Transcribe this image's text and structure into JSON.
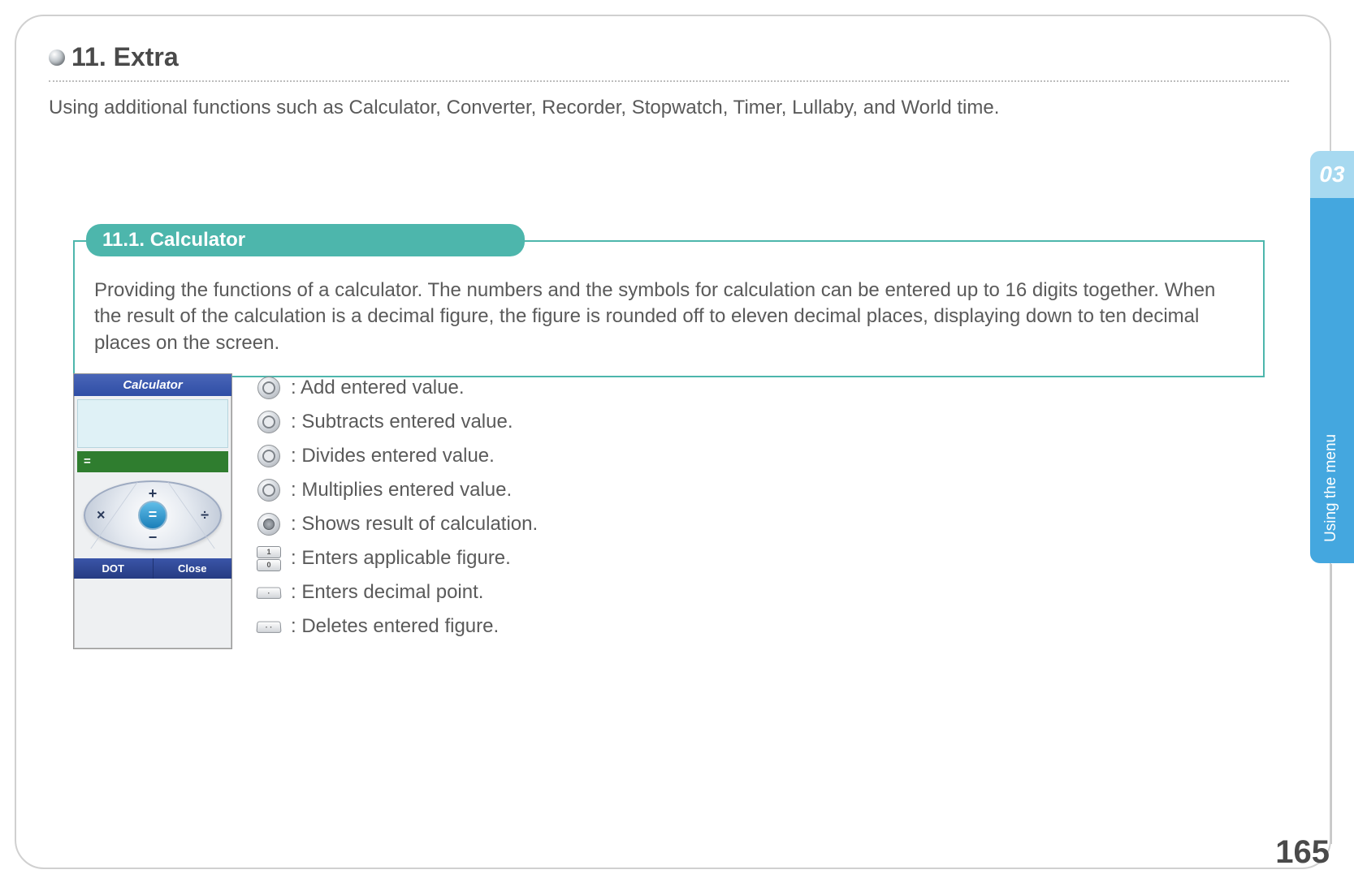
{
  "header": {
    "title": "11. Extra",
    "intro": "Using additional functions such as Calculator, Converter, Recorder, Stopwatch, Timer, Lullaby, and World time."
  },
  "section": {
    "tab": "11.1. Calculator",
    "body": "Providing the functions of a calculator. The numbers and the symbols for calculation can be entered up to 16 digits together. When the result of the calculation is a decimal figure, the figure is rounded off to eleven decimal places, displaying down to ten decimal places on the screen."
  },
  "calc": {
    "title": "Calculator",
    "eq": "=",
    "plus": "+",
    "minus": "−",
    "times": "×",
    "div": "÷",
    "soft_left": "DOT",
    "soft_right": "Close"
  },
  "legend": {
    "items": [
      ": Add entered value.",
      ": Subtracts entered value.",
      ": Divides entered value.",
      ": Multiplies entered value.",
      ": Shows result of calculation.",
      ": Enters applicable figure.",
      ": Enters decimal point.",
      ": Deletes entered figure."
    ],
    "numkey1": "1",
    "numkey0": "0"
  },
  "side": {
    "chapter": "03",
    "label": "Using the menu"
  },
  "page_number": "165"
}
